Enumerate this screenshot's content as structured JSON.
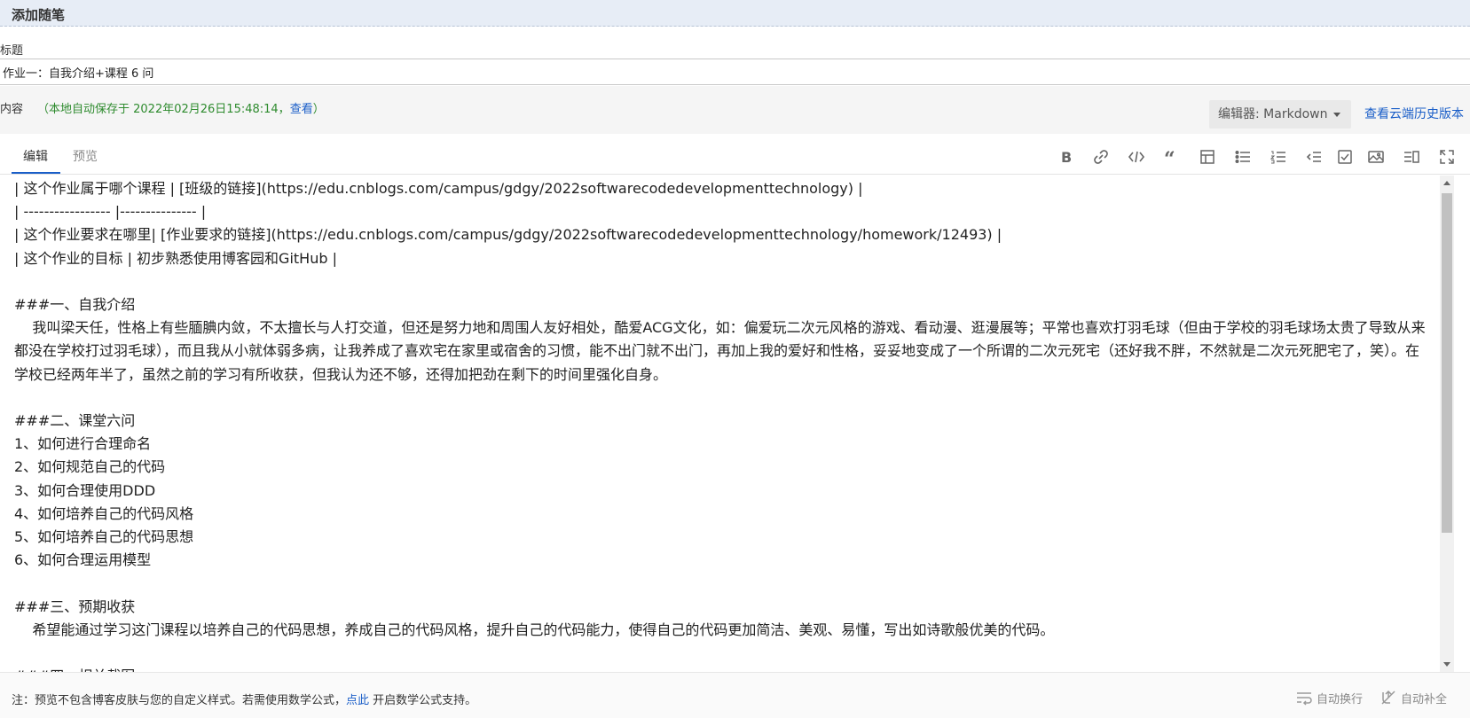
{
  "header": {
    "title": "添加随笔"
  },
  "title_field": {
    "label": "标题",
    "value": "作业一：自我介绍+课程 6 问"
  },
  "content": {
    "label": "内容",
    "autosave_prefix": "（本地自动保存于 2022年02月26日15:48:14，",
    "autosave_link": "查看",
    "autosave_suffix": "）",
    "editor_select": "编辑器: Markdown",
    "history_link": "查看云端历史版本"
  },
  "tabs": [
    {
      "label": "编辑"
    },
    {
      "label": "预览"
    }
  ],
  "toolbar": {
    "icons": [
      "bold-icon",
      "link-icon",
      "code-icon",
      "quote-icon",
      "table-icon",
      "unordered-list-icon",
      "ordered-list-icon",
      "indent-icon",
      "checkbox-icon",
      "image-icon",
      "split-view-icon",
      "fullscreen-icon"
    ]
  },
  "editor": {
    "text": "| 这个作业属于哪个课程 | [班级的链接](https://edu.cnblogs.com/campus/gdgy/2022softwarecodedevelopmenttechnology) |\n| ----------------- |--------------- |\n| 这个作业要求在哪里| [作业要求的链接](https://edu.cnblogs.com/campus/gdgy/2022softwarecodedevelopmenttechnology/homework/12493) |\n| 这个作业的目标 | 初步熟悉使用博客园和GitHub |\n\n###一、自我介绍\n    我叫梁天任，性格上有些腼腆内敛，不太擅长与人打交道，但还是努力地和周围人友好相处，酷爱ACG文化，如：偏爱玩二次元风格的游戏、看动漫、逛漫展等；平常也喜欢打羽毛球（但由于学校的羽毛球场太贵了导致从来都没在学校打过羽毛球），而且我从小就体弱多病，让我养成了喜欢宅在家里或宿舍的习惯，能不出门就不出门，再加上我的爱好和性格，妥妥地变成了一个所谓的二次元死宅（还好我不胖，不然就是二次元死肥宅了，笑）。在学校已经两年半了，虽然之前的学习有所收获，但我认为还不够，还得加把劲在剩下的时间里强化自身。\n\n###二、课堂六问\n1、如何进行合理命名\n2、如何规范自己的代码\n3、如何合理使用DDD\n4、如何培养自己的代码风格\n5、如何培养自己的代码思想\n6、如何合理运用模型\n\n###三、预期收获\n    希望能通过学习这门课程以培养自己的代码思想，养成自己的代码风格，提升自己的代码能力，使得自己的代码更加简洁、美观、易懂，写出如诗歌般优美的代码。\n\n###四、相关截图"
  },
  "footer": {
    "note_prefix": "注：预览不包含博客皮肤与您的自定义样式。若需使用数学公式，",
    "note_link": "点此",
    "note_suffix": " 开启数学公式支持。",
    "auto_wrap": "自动换行",
    "auto_complete": "自动补全"
  }
}
